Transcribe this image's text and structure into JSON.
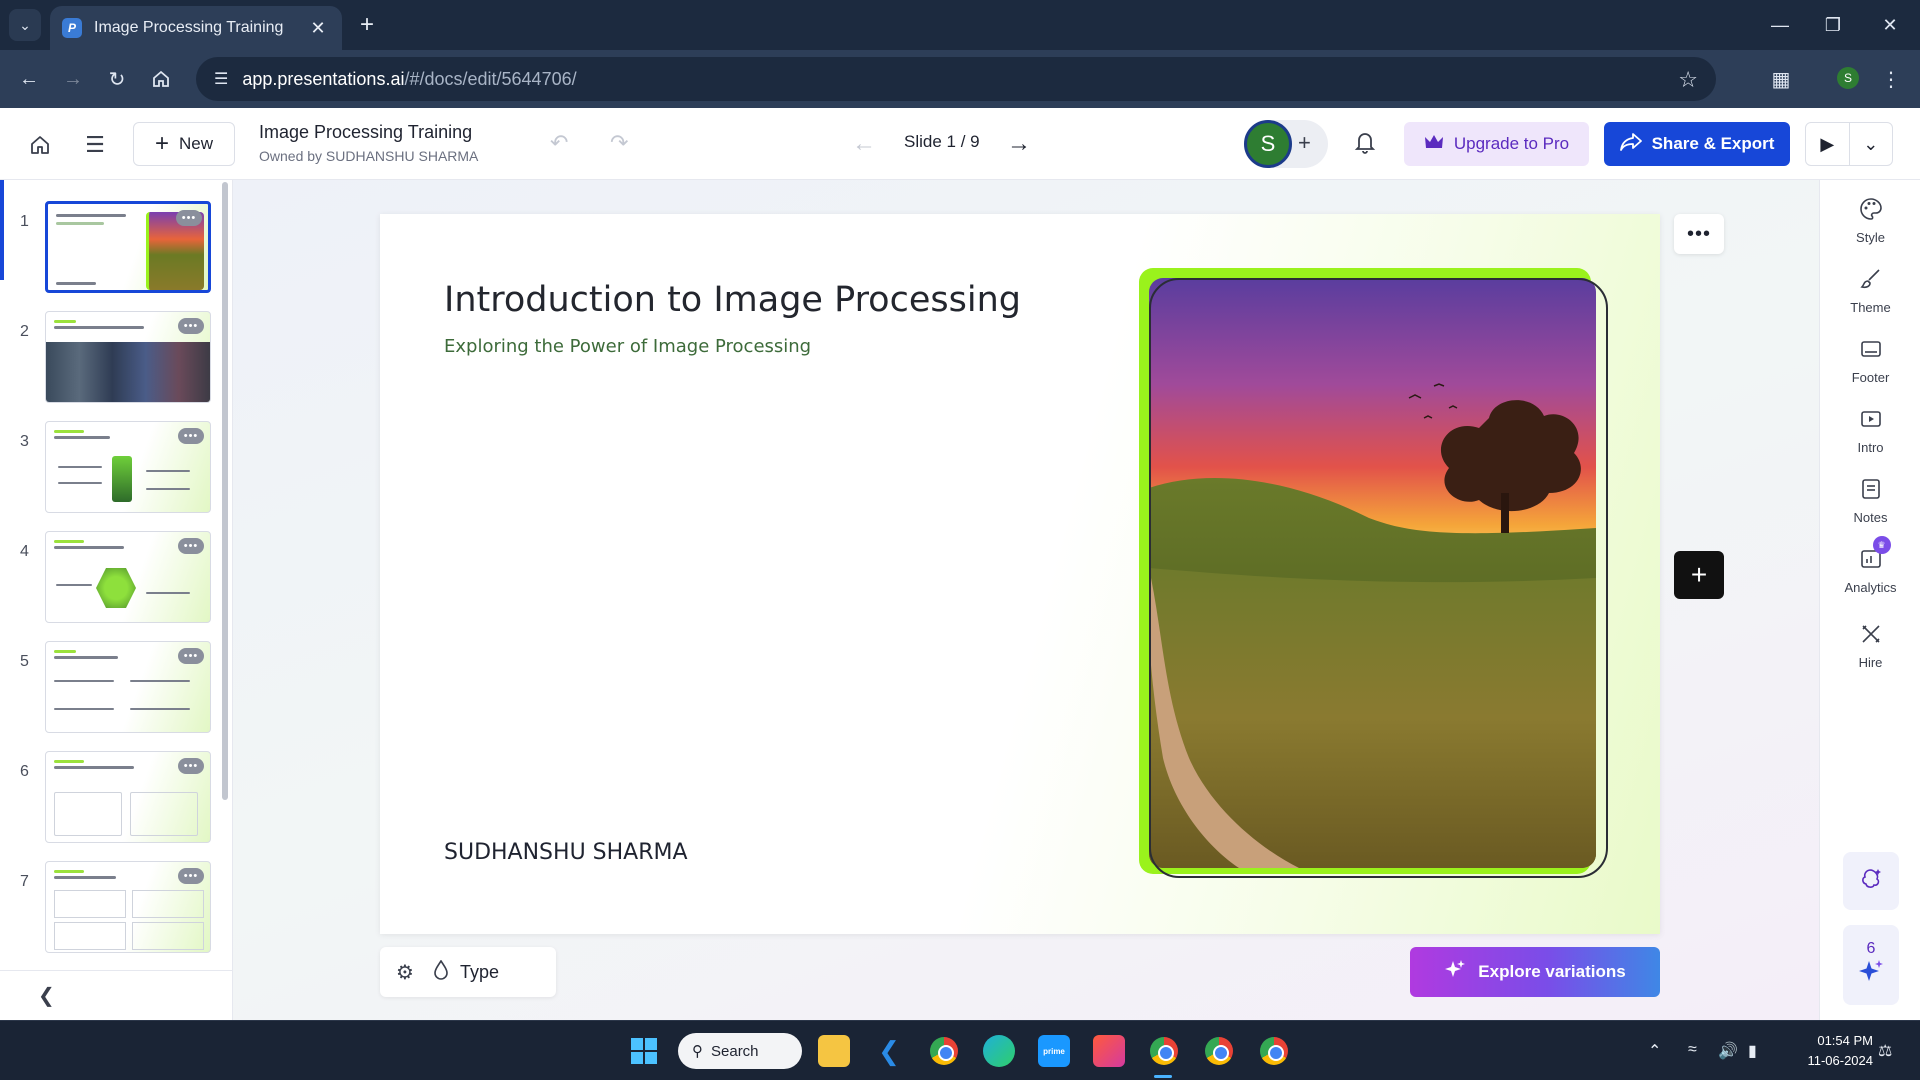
{
  "browser": {
    "tab_title": "Image Processing Training",
    "tab_favicon": "P",
    "url_host": "app.presentations.ai",
    "url_path": "/#/docs/edit/5644706/",
    "profile_initial": "S"
  },
  "header": {
    "new_label": "New",
    "doc_title": "Image Processing Training",
    "doc_owner": "Owned by SUDHANSHU SHARMA",
    "slide_counter": "Slide 1 / 9",
    "avatar_initial": "S",
    "upgrade_label": "Upgrade to Pro",
    "share_label": "Share & Export"
  },
  "thumbnails": [
    {
      "num": "1",
      "active": true
    },
    {
      "num": "2",
      "active": false
    },
    {
      "num": "3",
      "active": false
    },
    {
      "num": "4",
      "active": false
    },
    {
      "num": "5",
      "active": false
    },
    {
      "num": "6",
      "active": false
    },
    {
      "num": "7",
      "active": false
    }
  ],
  "slide": {
    "title": "Introduction to Image Processing",
    "subtitle": "Exploring the Power of Image Processing",
    "author": "SUDHANSHU SHARMA"
  },
  "bottom": {
    "type_label": "Type",
    "explore_label": "Explore variations"
  },
  "right_rail": {
    "items": [
      {
        "label": "Style",
        "icon": "palette-icon"
      },
      {
        "label": "Theme",
        "icon": "brush-icon"
      },
      {
        "label": "Footer",
        "icon": "footer-icon"
      },
      {
        "label": "Intro",
        "icon": "intro-icon"
      },
      {
        "label": "Notes",
        "icon": "notes-icon"
      },
      {
        "label": "Analytics",
        "icon": "analytics-icon"
      },
      {
        "label": "Hire",
        "icon": "hire-icon"
      }
    ],
    "assistant_count": "6"
  },
  "taskbar": {
    "search_label": "Search",
    "time": "01:54 PM",
    "date": "11-06-2024"
  },
  "colors": {
    "accent_blue": "#1747d8",
    "accent_green": "#9af21c",
    "upgrade_purple": "#5b2bbf"
  }
}
